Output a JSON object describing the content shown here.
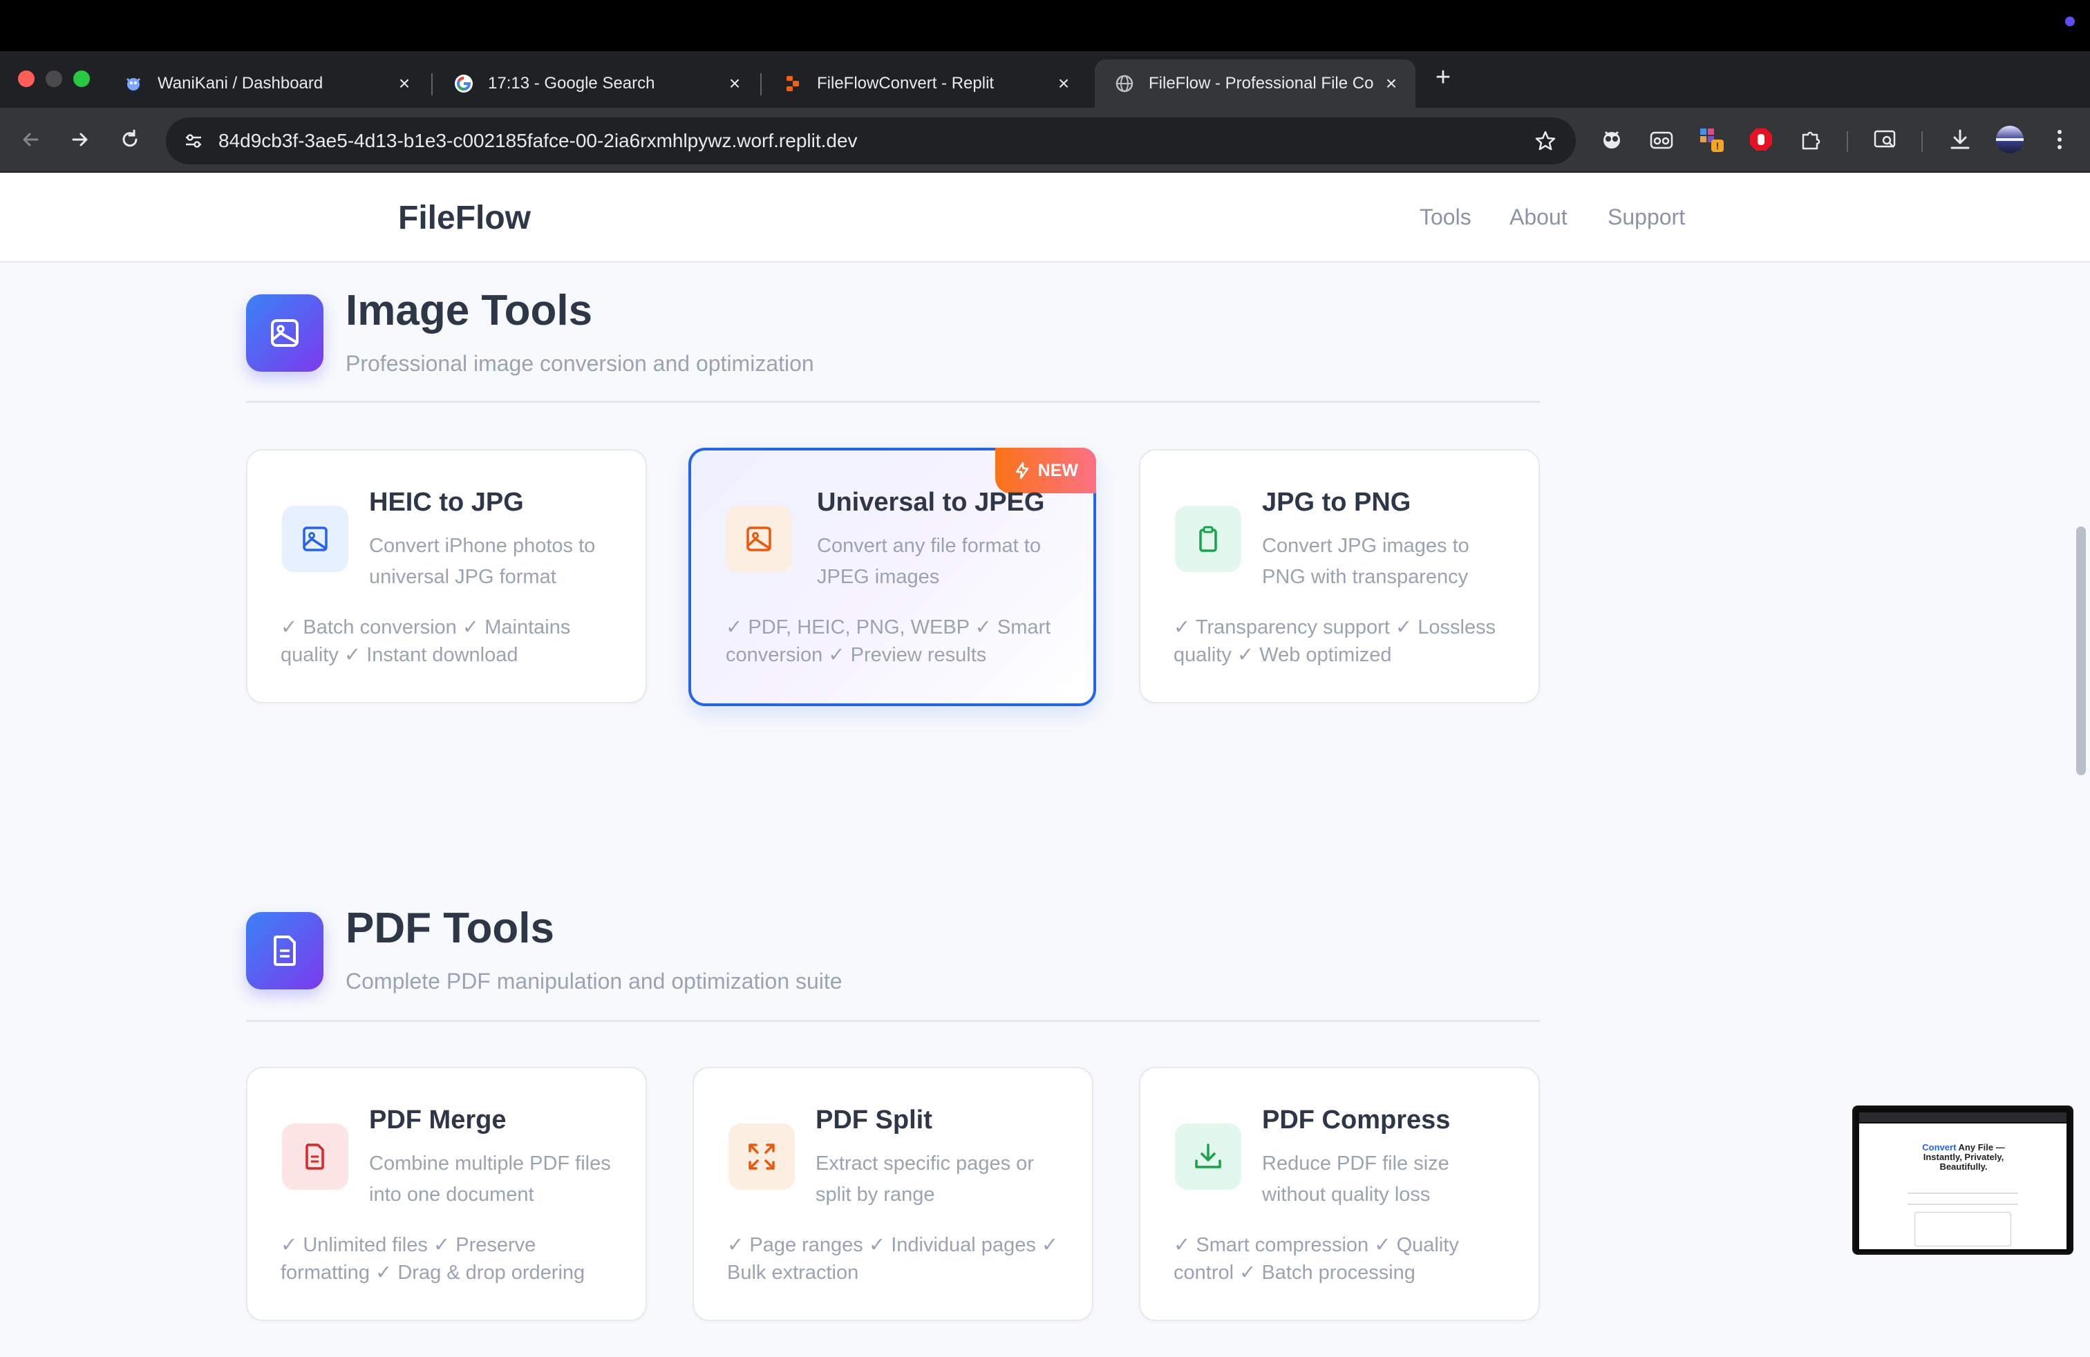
{
  "browser": {
    "tabs": [
      {
        "title": "WaniKani / Dashboard",
        "icon": "wanikani-crab-icon"
      },
      {
        "title": "17:13 - Google Search",
        "icon": "google-g-icon"
      },
      {
        "title": "FileFlowConvert - Replit",
        "icon": "replit-icon"
      },
      {
        "title": "FileFlow - Professional File Co",
        "icon": "globe-icon"
      }
    ],
    "new_tab_label": "+",
    "url": "84d9cb3f-3ae5-4d13-b1e3-c002185fafce-00-2ia6rxmhlpywz.worf.replit.dev"
  },
  "site": {
    "brand": "FileFlow",
    "nav": [
      "Tools",
      "About",
      "Support"
    ],
    "image_section": {
      "title": "Image Tools",
      "subtitle": "Professional image conversion and optimization",
      "cards": [
        {
          "title": "HEIC to JPG",
          "description": "Convert iPhone photos to universal JPG format",
          "features": "✓ Batch conversion ✓ Maintains quality ✓ Instant download",
          "icon": "image-icon"
        },
        {
          "title": "Universal to JPEG",
          "description": "Convert any file format to JPEG images",
          "features": "✓ PDF, HEIC, PNG, WEBP ✓ Smart conversion ✓ Preview results",
          "icon": "image-icon",
          "badge": "NEW"
        },
        {
          "title": "JPG to PNG",
          "description": "Convert JPG images to PNG with transparency",
          "features": "✓ Transparency support ✓ Lossless quality ✓ Web optimized",
          "icon": "clipboard-icon"
        }
      ]
    },
    "pdf_section": {
      "title": "PDF Tools",
      "subtitle": "Complete PDF manipulation and optimization suite",
      "cards": [
        {
          "title": "PDF Merge",
          "description": "Combine multiple PDF files into one document",
          "features": "✓ Unlimited files ✓ Preserve formatting ✓ Drag & drop ordering",
          "icon": "document-icon"
        },
        {
          "title": "PDF Split",
          "description": "Extract specific pages or split by range",
          "features": "✓ Page ranges ✓ Individual pages ✓ Bulk extraction",
          "icon": "expand-arrows-icon"
        },
        {
          "title": "PDF Compress",
          "description": "Reduce PDF file size without quality loss",
          "features": "✓ Smart compression ✓ Quality control ✓ Batch processing",
          "icon": "download-icon"
        }
      ]
    }
  },
  "pip_preview": {
    "accent_word": "Convert",
    "text": " Any File — Instantly, Privately, Beautifully."
  },
  "colors": {
    "accent_blue": "#2563eb",
    "section_gradient_start": "#3b82f6",
    "section_gradient_end": "#7c3aed",
    "badge_orange": "#f97316",
    "text_dark": "#2d3748",
    "text_muted": "#9aa3b2"
  }
}
